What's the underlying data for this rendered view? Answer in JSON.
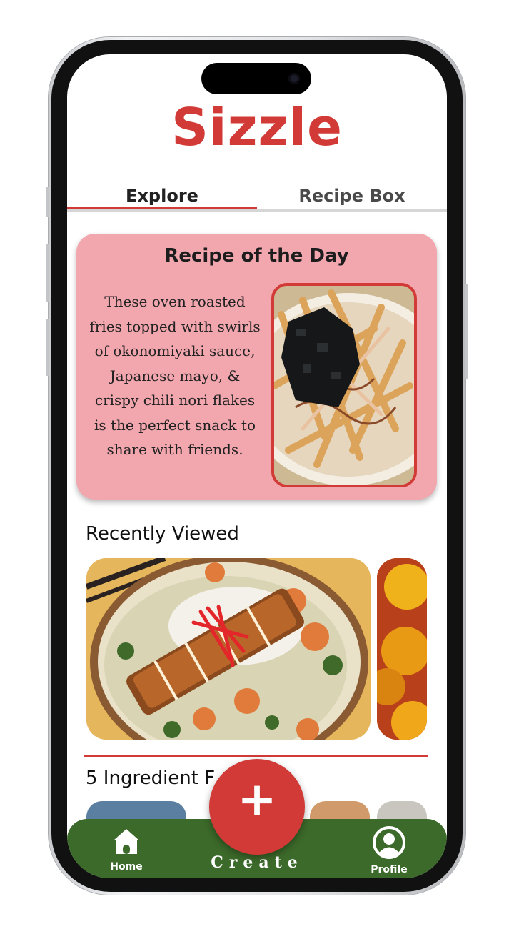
{
  "app": {
    "title": "Sizzle"
  },
  "tabs": [
    {
      "label": "Explore",
      "active": true
    },
    {
      "label": "Recipe Box",
      "active": false
    }
  ],
  "recipe_of_day": {
    "heading": "Recipe of the Day",
    "description": "These oven roasted fries topped with swirls of okonomiyaki sauce, Japanese mayo, & crispy chili nori flakes is the perfect snack to share with friends."
  },
  "recently_viewed": {
    "heading": "Recently Viewed"
  },
  "five_ingredient": {
    "heading": "5 Ingredient F"
  },
  "bottom_nav": {
    "home_label": "Home",
    "create_label": "Create",
    "profile_label": "Profile",
    "fab_symbol": "+"
  },
  "icons": [
    "home-icon",
    "plus-icon",
    "profile-icon"
  ],
  "colors": {
    "brand_red": "#d13a36",
    "card_pink": "#f2a6ae",
    "nav_green": "#3c6a2a"
  }
}
